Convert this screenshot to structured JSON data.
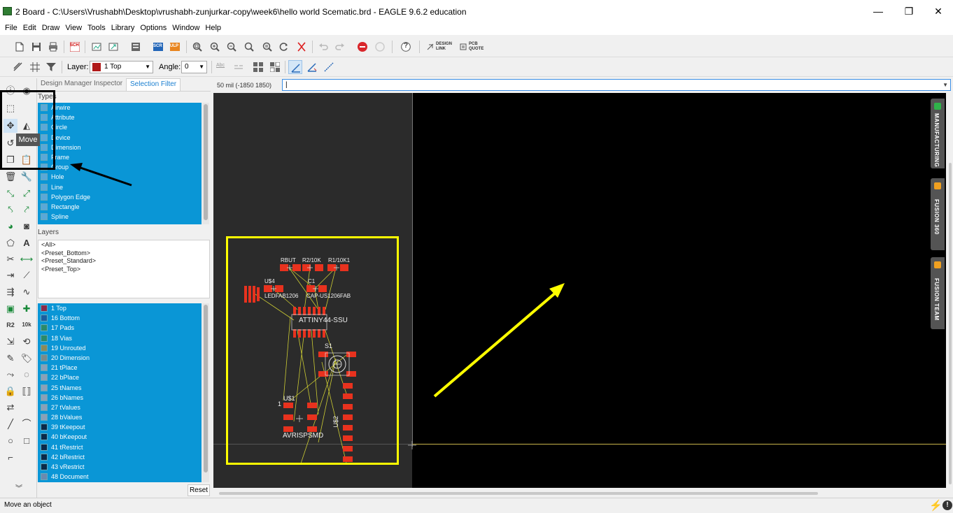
{
  "window": {
    "title": "2 Board - C:\\Users\\Vrushabh\\Desktop\\vrushabh-zunjurkar-copy\\week6\\hello world Scematic.brd - EAGLE 9.6.2 education",
    "minimize_glyph": "—",
    "restore_glyph": "❐",
    "close_glyph": "✕"
  },
  "menu": [
    "File",
    "Edit",
    "Draw",
    "View",
    "Tools",
    "Library",
    "Options",
    "Window",
    "Help"
  ],
  "toolbar": {
    "design_link_label_1": "DESIGN",
    "design_link_label_2": "LINK",
    "pcb_quote_label_1": "PCB",
    "pcb_quote_label_2": "QUOTE",
    "sch_label": "SCH",
    "scr_label": "SCR",
    "ulp_label": "ULP",
    "help_glyph": "?"
  },
  "params": {
    "layer_label": "Layer:",
    "layer_value": "1 Top",
    "layer_color": "#b01818",
    "angle_label": "Angle:",
    "angle_value": "0",
    "abc_label": "Abc"
  },
  "tooltip": {
    "text": "Move"
  },
  "panel": {
    "tabs": [
      "Design Manager",
      "Inspector",
      "Selection Filter"
    ],
    "active_tab": "Selection Filter",
    "types_label": "Types",
    "types": [
      "Airwire",
      "Attribute",
      "Circle",
      "Device",
      "Dimension",
      "Frame",
      "Group",
      "Hole",
      "Line",
      "Polygon Edge",
      "Rectangle",
      "Spline"
    ],
    "layers_label": "Layers",
    "presets": [
      "<All>",
      "<Preset_Bottom>",
      "<Preset_Standard>",
      "<Preset_Top>"
    ],
    "layers": [
      {
        "name": "1 Top",
        "color": "#8a2a4a"
      },
      {
        "name": "16 Bottom",
        "color": "#1a5ea0"
      },
      {
        "name": "17 Pads",
        "color": "#2a8a6a"
      },
      {
        "name": "18 Vias",
        "color": "#2a8a6a"
      },
      {
        "name": "19 Unrouted",
        "color": "#8a8a5a"
      },
      {
        "name": "20 Dimension",
        "color": "#7a8a8a"
      },
      {
        "name": "21 tPlace",
        "color": "#8aa0b8"
      },
      {
        "name": "22 bPlace",
        "color": "#8aa0b8"
      },
      {
        "name": "25 tNames",
        "color": "#8aa0b8"
      },
      {
        "name": "26 bNames",
        "color": "#8aa0b8"
      },
      {
        "name": "27 tValues",
        "color": "#8aa0b8"
      },
      {
        "name": "28 bValues",
        "color": "#8aa0b8"
      },
      {
        "name": "39 tKeepout",
        "color": "#0a2a4a"
      },
      {
        "name": "40 bKeepout",
        "color": "#0a2a4a"
      },
      {
        "name": "41 tRestrict",
        "color": "#0a2a4a"
      },
      {
        "name": "42 bRestrict",
        "color": "#0a2a4a"
      },
      {
        "name": "43 vRestrict",
        "color": "#0a2a4a"
      },
      {
        "name": "48 Document",
        "color": "#6a8ab0"
      }
    ],
    "reset_label": "Reset"
  },
  "coordinate_readout": "50 mil (-1850 1850)",
  "command_line_value": "|",
  "board": {
    "labels": {
      "rbut": "RBUT",
      "r2": "R2/10K",
      "r1": "R1/10K1",
      "u4": "U$4",
      "c1": "C1",
      "led": "LEDFAB1206",
      "cap": "CAP-US1206FAB",
      "ic": "ATTINY44-SSU",
      "s1": "S1",
      "u1": "U$1",
      "u2": "U$2",
      "avr": "AVRISPSMD",
      "one": "1"
    },
    "highlight_color": "#ffff00",
    "pad_color": "#e8321e",
    "airwire_color": "#cccc33"
  },
  "sidetabs": [
    {
      "label": "MANUFACTURING",
      "icon_color": "#2fb34a"
    },
    {
      "label": "FUSION 360",
      "icon_color": "#f0a020"
    },
    {
      "label": "FUSION TEAM",
      "icon_color": "#f0a020"
    }
  ],
  "status": {
    "message": "Move an object",
    "lightning_glyph": "⚡",
    "alert_glyph": "!"
  },
  "more_tools_glyph": "︾"
}
